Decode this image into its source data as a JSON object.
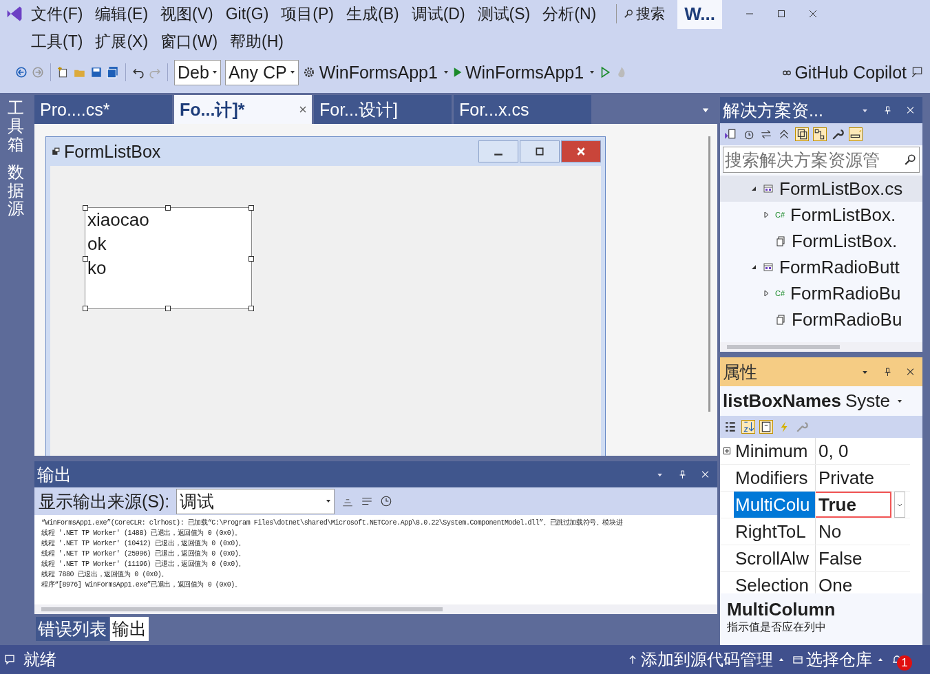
{
  "menu_rows": [
    [
      "文件(F)",
      "编辑(E)",
      "视图(V)",
      "Git(G)",
      "项目(P)",
      "生成(B)",
      "调试(D)",
      "测试(S)",
      "分析(N)"
    ],
    [
      "工具(T)",
      "扩展(X)",
      "窗口(W)",
      "帮助(H)"
    ]
  ],
  "search": {
    "label": "搜索"
  },
  "title_box": "W...",
  "toolbar": {
    "config": "Deb",
    "platform": "Any CP",
    "project": "WinFormsApp1",
    "run_target": "WinFormsApp1",
    "copilot": "GitHub Copilot"
  },
  "side_tabs": [
    "工具箱",
    "数据源"
  ],
  "doc_tabs": [
    {
      "label": "Pro....cs*",
      "selected": false
    },
    {
      "label": "Fo...计]*",
      "selected": true
    },
    {
      "label": "For...设计]",
      "selected": false
    },
    {
      "label": "For...x.cs",
      "selected": false
    }
  ],
  "form": {
    "title": "FormListBox",
    "items": [
      "xiaocao",
      "ok",
      "ko"
    ]
  },
  "output": {
    "title": "输出",
    "source_label": "显示输出来源(S):",
    "source": "调试",
    "lines": [
      "“WinFormsApp1.exe”(CoreCLR: clrhost): 已加载“C:\\Program Files\\dotnet\\shared\\Microsoft.NETCore.App\\8.0.22\\System.ComponentModel.dll”。已跳过加载符号。模块进",
      "线程 '.NET TP Worker' (1488) 已退出，返回值为 0 (0x0)。",
      "线程 '.NET TP Worker' (10412) 已退出，返回值为 0 (0x0)。",
      "线程 '.NET TP Worker' (25996) 已退出，返回值为 0 (0x0)。",
      "线程 '.NET TP Worker' (11196) 已退出，返回值为 0 (0x0)。",
      "线程 7880 已退出，返回值为 0 (0x0)。",
      "程序“[8976] WinFormsApp1.exe”已退出，返回值为 0 (0x0)。"
    ]
  },
  "bottom_tabs": [
    {
      "label": "错误列表",
      "selected": false
    },
    {
      "label": "输出",
      "selected": true
    }
  ],
  "solution_explorer": {
    "title": "解决方案资...",
    "search_placeholder": "搜索解决方案资源管",
    "tree": [
      {
        "label": "FormListBox.cs",
        "kind": "form",
        "expanded": true,
        "selected": true,
        "children": [
          {
            "label": "FormListBox.",
            "kind": "cs",
            "badge": "C#",
            "expanded": false,
            "selected": false
          },
          {
            "label": "FormListBox.",
            "kind": "resx",
            "selected": false
          }
        ]
      },
      {
        "label": "FormRadioButt",
        "kind": "form",
        "expanded": true,
        "selected": false,
        "children": [
          {
            "label": "FormRadioBu",
            "kind": "cs",
            "badge": "C#",
            "expanded": false,
            "selected": false
          },
          {
            "label": "FormRadioBu",
            "kind": "resx",
            "selected": false
          }
        ]
      }
    ]
  },
  "properties": {
    "title": "属性",
    "object": "listBoxNames",
    "type": "Syste",
    "rows": [
      {
        "name": "Minimum",
        "value": "0, 0",
        "expandable": true,
        "selected": false
      },
      {
        "name": "Modifiers",
        "value": "Private",
        "expandable": false,
        "selected": false
      },
      {
        "name": "MultiColu",
        "value": "True",
        "expandable": false,
        "selected": true
      },
      {
        "name": "RightToL",
        "value": "No",
        "expandable": false,
        "selected": false
      },
      {
        "name": "ScrollAlw",
        "value": "False",
        "expandable": false,
        "selected": false
      },
      {
        "name": "Selection",
        "value": "One",
        "expandable": false,
        "selected": false
      }
    ],
    "description_title": "MultiColumn",
    "description": "指示值是否应在列中"
  },
  "status": {
    "text": "就绪",
    "source_control": "添加到源代码管理",
    "repo": "选择仓库",
    "notifications": "1"
  }
}
